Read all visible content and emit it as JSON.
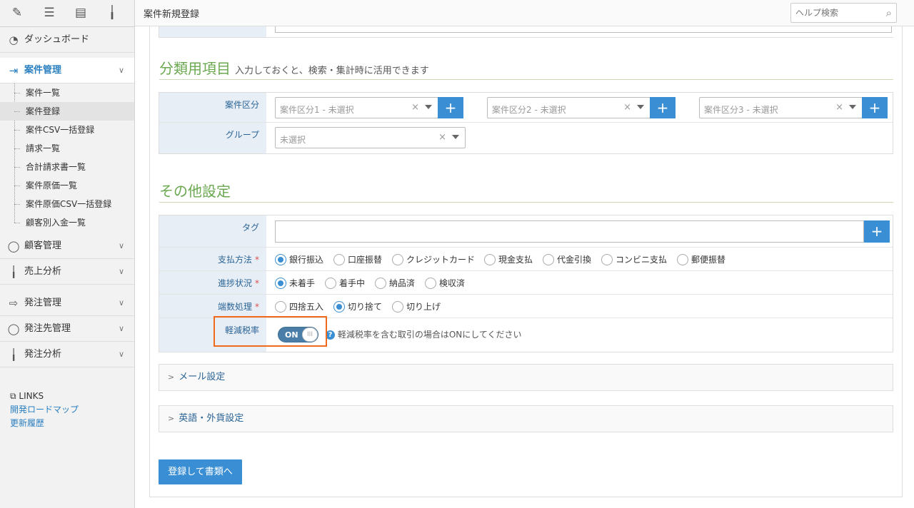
{
  "toolbar": {
    "icons": [
      "pencil-icon",
      "list-icon",
      "document-list-icon",
      "chart-icon"
    ]
  },
  "sidebar": {
    "items": [
      {
        "label": "ダッシュボード",
        "icon": "dashboard-icon"
      },
      {
        "label": "案件管理",
        "icon": "login-arrow-icon",
        "expanded": true
      },
      {
        "label": "顧客管理",
        "icon": "user-circle-icon"
      },
      {
        "label": "売上分析",
        "icon": "chart-icon"
      },
      {
        "label": "発注管理",
        "icon": "share-arrow-icon"
      },
      {
        "label": "発注先管理",
        "icon": "user-circle-icon"
      },
      {
        "label": "発注分析",
        "icon": "chart-icon"
      }
    ],
    "subitems": [
      "案件一覧",
      "案件登録",
      "案件CSV一括登録",
      "請求一覧",
      "合計請求書一覧",
      "案件原価一覧",
      "案件原価CSV一括登録",
      "顧客別入金一覧"
    ],
    "links": {
      "header": "LINKS",
      "items": [
        "開発ロードマップ",
        "更新履歴"
      ]
    }
  },
  "header": {
    "title": "案件新規登録",
    "search_placeholder": "ヘルプ検索"
  },
  "classification": {
    "title": "分類用項目",
    "desc": "入力しておくと、検索・集計時に活用できます",
    "category_label": "案件区分",
    "category_selects": [
      "案件区分1 - 未選択",
      "案件区分2 - 未選択",
      "案件区分3 - 未選択"
    ],
    "group_label": "グループ",
    "group_select": "未選択"
  },
  "other": {
    "title": "その他設定",
    "tag_label": "タグ",
    "payment": {
      "label": "支払方法",
      "options": [
        "銀行振込",
        "口座振替",
        "クレジットカード",
        "現金支払",
        "代金引換",
        "コンビニ支払",
        "郵便振替"
      ],
      "selected": 0
    },
    "progress": {
      "label": "進捗状況",
      "options": [
        "未着手",
        "着手中",
        "納品済",
        "検収済"
      ],
      "selected": 0
    },
    "rounding": {
      "label": "端数処理",
      "options": [
        "四捨五入",
        "切り捨て",
        "切り上げ"
      ],
      "selected": 1
    },
    "reduced_tax": {
      "label": "軽減税率",
      "toggle": "ON",
      "knob": "III",
      "help": "軽減税率を含む取引の場合はONにしてください"
    },
    "required_mark": "*"
  },
  "collapsibles": [
    "メール設定",
    "英語・外貨設定"
  ],
  "submit_label": "登録して書類へ"
}
